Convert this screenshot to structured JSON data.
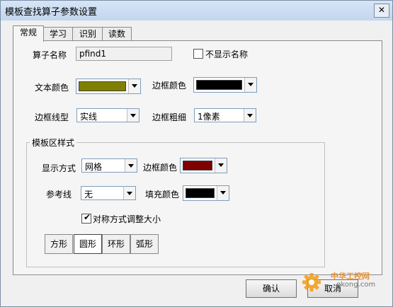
{
  "window": {
    "title": "模板查找算子参数设置",
    "close_glyph": "✕"
  },
  "tabs": [
    {
      "label": "常规",
      "active": true
    },
    {
      "label": "学习",
      "active": false
    },
    {
      "label": "识别",
      "active": false
    },
    {
      "label": "读数",
      "active": false
    }
  ],
  "general": {
    "name_label": "算子名称",
    "name_value": "pfind1",
    "hide_name_label": "不显示名称",
    "hide_name_checked": false,
    "text_color_label": "文本颜色",
    "text_color": "#808000",
    "border_color_label": "边框颜色",
    "border_color": "#000000",
    "border_style_label": "边框线型",
    "border_style_value": "实线",
    "border_width_label": "边框粗细",
    "border_width_value": "1像素"
  },
  "template_style": {
    "group_title": "模板区样式",
    "display_mode_label": "显示方式",
    "display_mode_value": "网格",
    "border_color_label": "边框颜色",
    "border_color": "#800000",
    "ref_line_label": "参考线",
    "ref_line_value": "无",
    "fill_color_label": "填充颜色",
    "fill_color": "#000000",
    "symmetric_label": "对称方式调整大小",
    "symmetric_checked": true,
    "shapes": [
      {
        "label": "方形",
        "pressed": false
      },
      {
        "label": "圆形",
        "pressed": true
      },
      {
        "label": "环形",
        "pressed": false
      },
      {
        "label": "弧形",
        "pressed": false
      }
    ]
  },
  "buttons": {
    "ok": "确认",
    "cancel": "取消"
  },
  "watermark": {
    "brand": "中华工控网",
    "site": "gkong.com"
  }
}
